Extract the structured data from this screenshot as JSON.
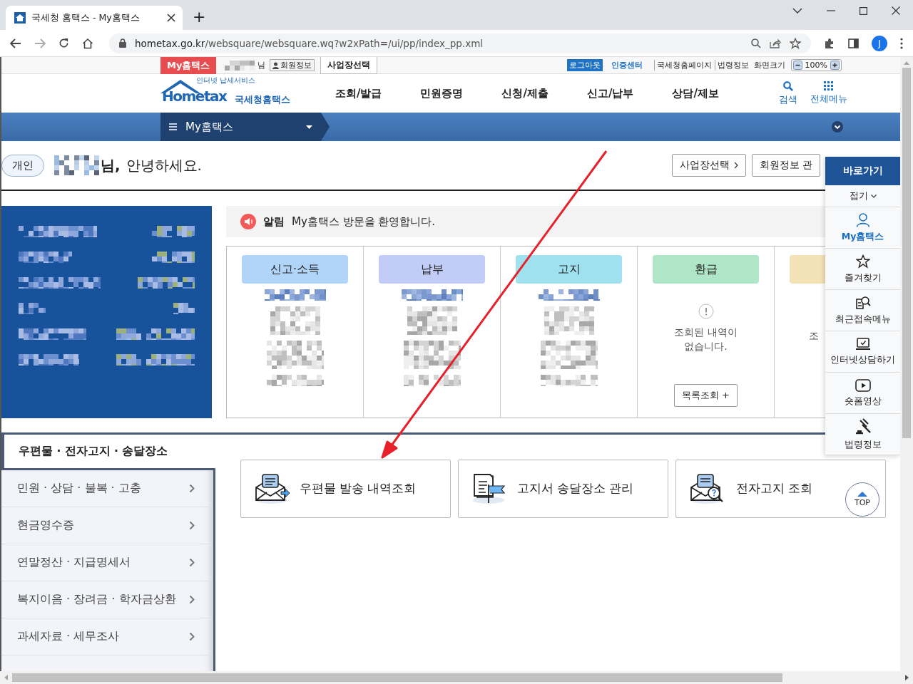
{
  "browser": {
    "tab_title": "국세청 홈택스 - My홈택스",
    "new_tab": "+",
    "url_host": "hometax.go.kr",
    "url_path": "/websquare/websquare.wq?w2xPath=/ui/pp/index_pp.xml",
    "profile_initial": "J"
  },
  "util_bar": {
    "my_label": "My홈택스",
    "name_suffix": "님",
    "member_info": "회원정보",
    "workplace": "사업장선택",
    "logout": "로그아웃",
    "cert_center": "인증센터",
    "links": [
      "국세청홈페이지",
      "법령정보"
    ],
    "zoom_label": "화면크기",
    "zoom_value": "100%"
  },
  "header": {
    "tagline": "인터넷 납세서비스",
    "logo": "Hometax",
    "logo_kr": "국세청홈택스",
    "nav": [
      "조회/발급",
      "민원증명",
      "신청/제출",
      "신고/납부",
      "상담/제보"
    ],
    "search": "검색",
    "all_menu": "전체메뉴"
  },
  "menu_bar": {
    "label": "My홈택스"
  },
  "greeting": {
    "badge": "개인",
    "name_suffix": "님,",
    "text": "안녕하세요.",
    "buttons": [
      {
        "label": "사업장선택",
        "chevron": true
      },
      {
        "label": "회원정보 관",
        "chevron": false
      }
    ]
  },
  "notice": {
    "label": "알림",
    "text": "My홈택스 방문을 환영합니다."
  },
  "summary_cards": [
    {
      "kind": "blurred",
      "title": "신고·소득",
      "color": "#b1d5f8"
    },
    {
      "kind": "blurred",
      "title": "납부",
      "color": "#c2cdf7"
    },
    {
      "kind": "blurred",
      "title": "고지",
      "color": "#a0e1ef"
    },
    {
      "kind": "empty",
      "title": "환급",
      "color": "#b0e6c8",
      "message": "조회된 내역이 없습니다.",
      "button": "목록조회 +"
    },
    {
      "kind": "partial",
      "color": "#f2e2b5",
      "message": "조"
    }
  ],
  "section": {
    "title": "우편물 · 전자고지 · 송달장소",
    "menu": [
      "민원 · 상담 · 불복 · 고충",
      "현금영수증",
      "연말정산 · 지급명세서",
      "복지이음 · 장려금 · 학자금상환",
      "과세자료 · 세무조사"
    ],
    "services": [
      {
        "label": "우편물 발송 내역조회",
        "kind": "mail-send"
      },
      {
        "label": "고지서 송달장소 관리",
        "kind": "document-flag"
      },
      {
        "label": "전자고지 조회",
        "kind": "mail-search"
      }
    ]
  },
  "quick_menu": {
    "title": "바로가기",
    "collapse": "접기",
    "items": [
      {
        "label": "My홈택스",
        "kind": "user",
        "selected": true
      },
      {
        "label": "즐겨찾기",
        "kind": "star",
        "selected": false
      },
      {
        "label": "최근접속메뉴",
        "kind": "recent",
        "selected": false
      },
      {
        "label": "인터넷상담하기",
        "kind": "consult",
        "selected": false
      },
      {
        "label": "숏폼영상",
        "kind": "video",
        "selected": false
      },
      {
        "label": "법령정보",
        "kind": "law",
        "selected": false
      }
    ]
  },
  "top_button": "TOP"
}
